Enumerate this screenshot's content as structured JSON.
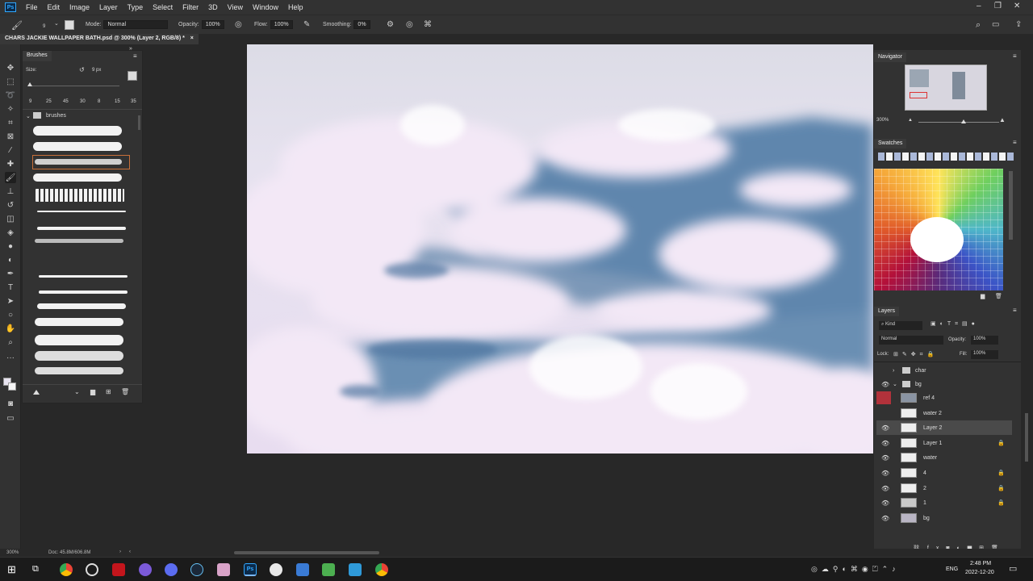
{
  "app": {
    "logo": "Ps",
    "accent": "#31a8ff"
  },
  "menu": [
    "File",
    "Edit",
    "Image",
    "Layer",
    "Type",
    "Select",
    "Filter",
    "3D",
    "View",
    "Window",
    "Help"
  ],
  "options": {
    "size_value": "9",
    "mode_label": "Mode:",
    "mode_value": "Normal",
    "opacity_label": "Opacity:",
    "opacity_value": "100%",
    "flow_label": "Flow:",
    "flow_value": "100%",
    "smoothing_label": "Smoothing:",
    "smoothing_value": "0%"
  },
  "document_tab": {
    "title": "CHARS JACKIE WALLPAPER BATH.psd @ 300% (Layer 2, RGB/8) *",
    "close": "×"
  },
  "brushes_panel": {
    "tab": "Brushes",
    "size_label": "Size:",
    "size_value": "9 px",
    "presets": [
      "9",
      "25",
      "45",
      "30",
      "8",
      "15",
      "35"
    ],
    "folder": "brushes"
  },
  "navigator": {
    "tab": "Navigator",
    "zoom": "300%"
  },
  "swatches": {
    "tab": "Swatches"
  },
  "layers_panel": {
    "tab": "Layers",
    "filter": "Kind",
    "blend_mode": "Normal",
    "opacity_label": "Opacity:",
    "opacity_value": "100%",
    "lock_label": "Lock:",
    "fill_label": "Fill:",
    "fill_value": "100%",
    "layers": [
      {
        "name": "char",
        "group": true
      },
      {
        "name": "bg",
        "group": true
      },
      {
        "name": "ref 4"
      },
      {
        "name": "water 2"
      },
      {
        "name": "Layer 2",
        "selected": true
      },
      {
        "name": "Layer 1"
      },
      {
        "name": "water"
      },
      {
        "name": "4"
      },
      {
        "name": "2"
      },
      {
        "name": "1"
      },
      {
        "name": "bg"
      }
    ]
  },
  "status": {
    "zoom": "300%",
    "doc": "Doc: 45.8M/606.8M"
  },
  "taskbar": {
    "time": "2:48 PM",
    "date": "2022-12-20",
    "lang": "ENG"
  }
}
